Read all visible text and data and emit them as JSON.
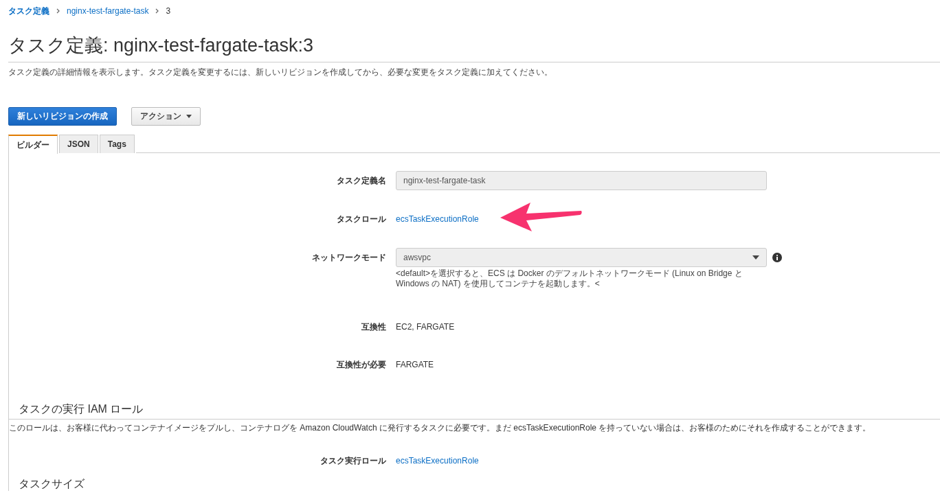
{
  "breadcrumb": [
    {
      "label": "タスク定義",
      "kind": "link"
    },
    {
      "label": "nginx-test-fargate-task",
      "kind": "link"
    },
    {
      "label": "3",
      "kind": "text"
    }
  ],
  "title": "タスク定義: nginx-test-fargate-task:3",
  "description": "タスク定義の詳細情報を表示します。タスク定義を変更するには、新しいリビジョンを作成してから、必要な変更をタスク定義に加えてください。",
  "buttons": [
    {
      "label": "新しいリビジョンの作成",
      "kind": "primary"
    },
    {
      "label": "アクション",
      "kind": "dropdown"
    }
  ],
  "tabs": [
    {
      "label": "ビルダー",
      "selected": true
    },
    {
      "label": "JSON",
      "selected": false
    },
    {
      "label": "Tags",
      "selected": false
    }
  ],
  "fields": [
    {
      "label": "タスク定義名",
      "kind": "input",
      "value": "nginx-test-fargate-task"
    },
    {
      "label": "タスクロール",
      "kind": "link",
      "value": "ecsTaskExecutionRole",
      "annotated": true
    },
    {
      "label": "ネットワークモード",
      "kind": "select",
      "value": "awsvpc",
      "help": "<default>を選択すると、ECS は Docker のデフォルトネットワークモード (Linux on Bridge と Windows の NAT) を使用してコンテナを起動します。<"
    },
    {
      "label": "互換性",
      "kind": "text",
      "value": "EC2, FARGATE"
    },
    {
      "label": "互換性が必要",
      "kind": "text",
      "value": "FARGATE"
    }
  ],
  "section": {
    "heading": "タスクの実行 IAM ロール",
    "description": "このロールは、お客様に代わってコンテナイメージをプルし、コンテナログを Amazon CloudWatch に発行するタスクに必要です。まだ ecsTaskExecutionRole を持っていない場合は、お客様のためにそれを作成することができます。",
    "fields": [
      {
        "label": "タスク実行ロール",
        "kind": "link",
        "value": "ecsTaskExecutionRole"
      }
    ]
  },
  "next_heading": "タスクサイズ"
}
